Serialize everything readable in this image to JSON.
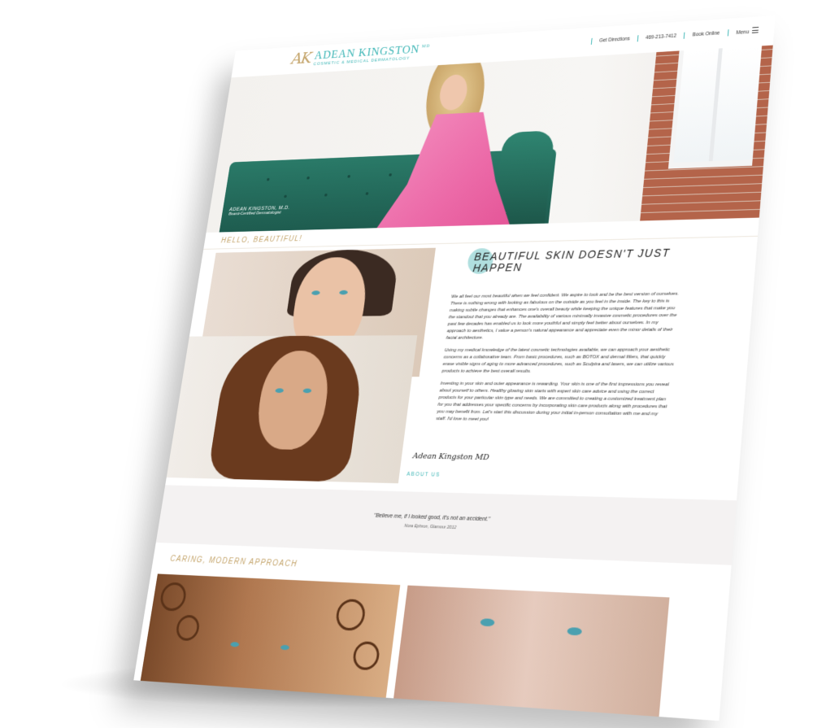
{
  "header": {
    "logo_mark": "AK",
    "logo_name": "ADEAN KINGSTON",
    "logo_md": "MD",
    "logo_subtitle": "COSMETIC & MEDICAL DERMATOLOGY",
    "nav": {
      "directions": "Get Directions",
      "phone": "469-213-7412",
      "book": "Book Online",
      "menu": "Menu"
    }
  },
  "hero": {
    "name": "ADEAN KINGSTON, M.D.",
    "title": "Board-Certified Dermatologist"
  },
  "intro": {
    "eyebrow": "HELLO, BEAUTIFUL!",
    "headline": "BEAUTIFUL SKIN DOESN'T JUST HAPPEN",
    "paragraphs": [
      "We all feel our most beautiful when we feel confident. We aspire to look and be the best version of ourselves. There is nothing wrong with looking as fabulous on the outside as you feel in the inside. The key to this is making subtle changes that enhances one's overall beauty while keeping the unique features that make you the standout that you already are. The availability of various minimally invasive cosmetic procedures over the past few decades has enabled us to look more youthful and simply feel better about ourselves. In my approach to aesthetics, I value a person's natural appearance and appreciate even the minor details of their facial architecture.",
      "Using my medical knowledge of the latest cosmetic technologies available, we can approach your aesthetic concerns as a collaborative team. From basic procedures, such as BOTOX and dermal fillers, that quickly erase visible signs of aging to more advanced procedures, such as Sculptra and lasers, we can utilize various products to achieve the best overall results.",
      "Investing in your skin and outer appearance is rewarding. Your skin is one of the first impressions you reveal about yourself to others. Healthy glowing skin starts with expert skin care advice and using the correct products for your particular skin type and needs. We are committed to creating a customized treatment plan for you that addresses your specific concerns by incorporating skin care products along with procedures that you may benefit from. Let's start this discussion during your initial in-person consultation with me and my staff. I'd love to meet you!"
    ],
    "signature": "Adean Kingston MD",
    "about_link": "ABOUT US"
  },
  "quote": {
    "text": "\"Believe me, if I looked good, it's not an accident.\"",
    "attribution": "Nora Ephron, Glamour 2012"
  },
  "approach": {
    "eyebrow": "CARING, MODERN APPROACH"
  },
  "icons": {
    "menu": "menu-icon",
    "logo": "logo-icon"
  },
  "colors": {
    "accent_teal": "#3bb5b5",
    "accent_gold": "#c4a46a",
    "sofa_green": "#2a7a68",
    "dress_pink": "#ec6aa8"
  }
}
